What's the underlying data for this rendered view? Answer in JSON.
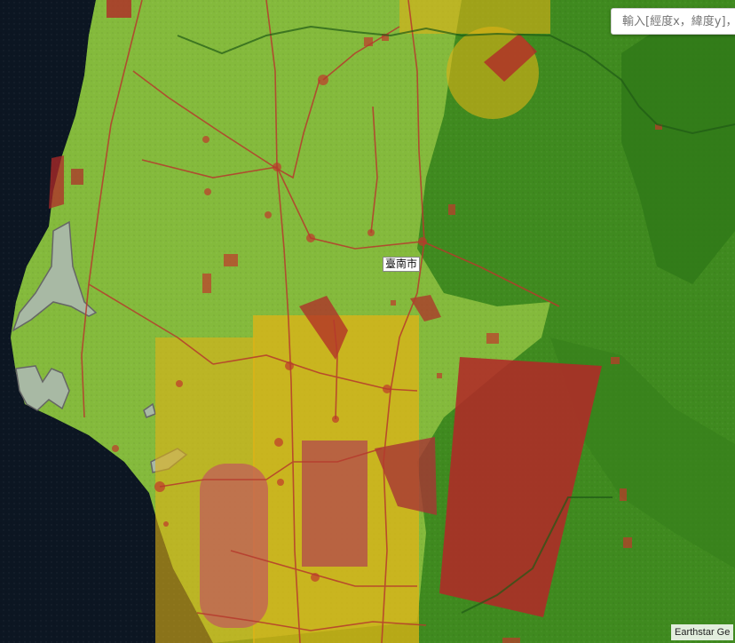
{
  "search": {
    "placeholder": "輸入[經度x，緯度y]，"
  },
  "map": {
    "city_label": "臺南市",
    "attribution": "Earthstar Ge",
    "colors": {
      "sea": "#0c1622",
      "land": "#3f8a1f",
      "farmland": "#84ba3c",
      "red_zone": "#b02a28",
      "yellow_zone": "#e0b315",
      "wetland": "#a8b9a4"
    }
  }
}
